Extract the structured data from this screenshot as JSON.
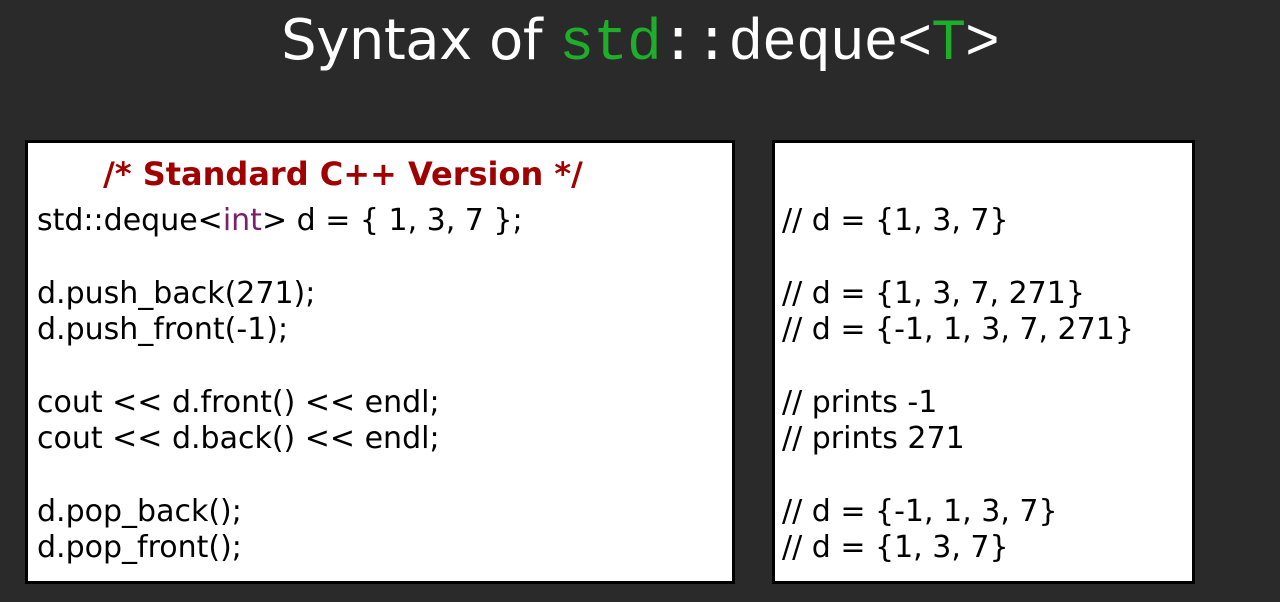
{
  "title": {
    "prefix": "Syntax of ",
    "code_std": "std",
    "code_sep": "::",
    "code_deque": "deque",
    "code_lt": "<",
    "code_t": "T",
    "code_gt": ">"
  },
  "left_panel": {
    "heading": "/* Standard C++ Version */",
    "line1_pre": "std::deque<",
    "line1_kw": "int",
    "line1_post": "> d = { 1, 3, 7 };",
    "lines": [
      "d.push_back(271);",
      "d.push_front(-1);",
      "cout << d.front() << endl;",
      "cout << d.back() << endl;",
      "d.pop_back();",
      "d.pop_front();"
    ]
  },
  "right_panel": {
    "comments": [
      "// d = {1, 3, 7}",
      "// d = {1, 3, 7, 271}",
      "// d = {-1, 1, 3, 7, 271}",
      "// prints -1",
      "// prints 271",
      "// d = {-1, 1, 3, 7}",
      "// d = {1, 3, 7}"
    ]
  }
}
